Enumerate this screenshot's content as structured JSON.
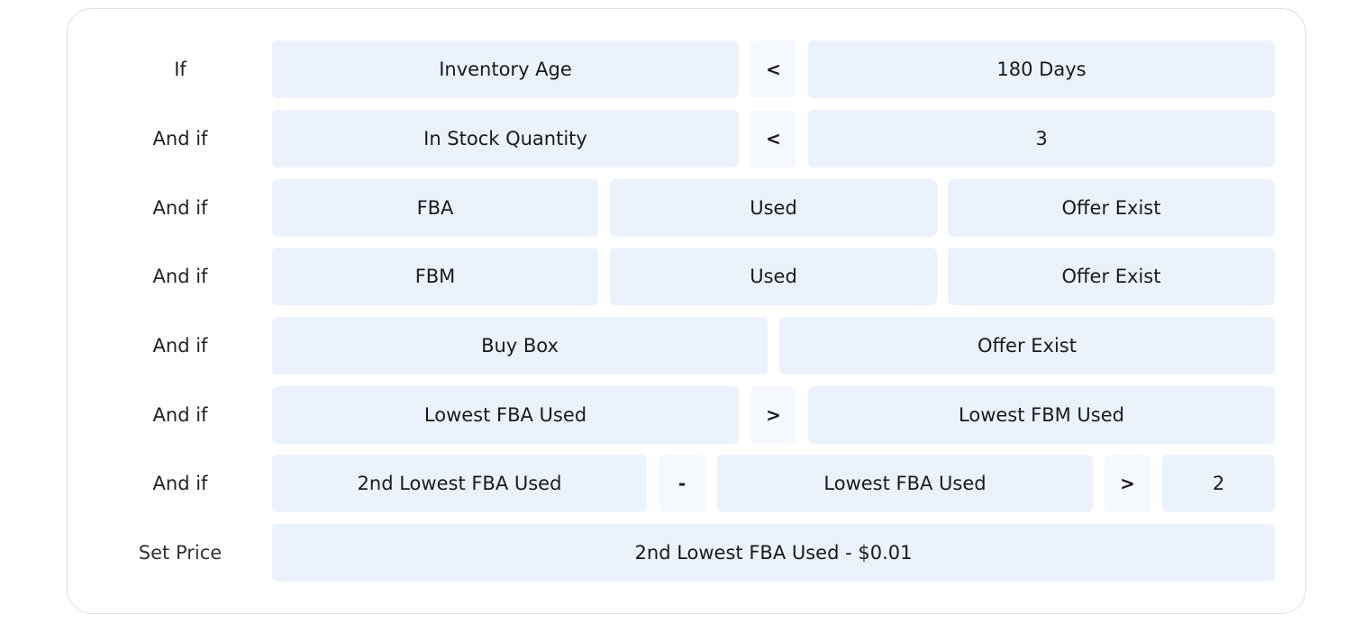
{
  "rules": [
    {
      "label": "If",
      "cells": [
        {
          "text": "Inventory Age",
          "type": "field"
        },
        {
          "text": "<",
          "type": "operator"
        },
        {
          "text": "180 Days",
          "type": "value"
        }
      ]
    },
    {
      "label": "And if",
      "cells": [
        {
          "text": "In Stock Quantity",
          "type": "field"
        },
        {
          "text": "<",
          "type": "operator"
        },
        {
          "text": "3",
          "type": "value"
        }
      ]
    },
    {
      "label": "And if",
      "cells": [
        {
          "text": "FBA",
          "type": "field"
        },
        {
          "text": "Used",
          "type": "field"
        },
        {
          "text": "Offer Exist",
          "type": "value"
        }
      ]
    },
    {
      "label": "And if",
      "cells": [
        {
          "text": "FBM",
          "type": "field"
        },
        {
          "text": "Used",
          "type": "field"
        },
        {
          "text": "Offer Exist",
          "type": "value"
        }
      ]
    },
    {
      "label": "And if",
      "cells": [
        {
          "text": "Buy Box",
          "type": "field"
        },
        {
          "text": "Offer Exist",
          "type": "value"
        }
      ]
    },
    {
      "label": "And if",
      "cells": [
        {
          "text": "Lowest FBA Used",
          "type": "field"
        },
        {
          "text": ">",
          "type": "operator"
        },
        {
          "text": "Lowest FBM Used",
          "type": "field"
        }
      ]
    },
    {
      "label": "And if",
      "cells": [
        {
          "text": "2nd Lowest FBA Used",
          "type": "field"
        },
        {
          "text": "-",
          "type": "operator"
        },
        {
          "text": "Lowest FBA Used",
          "type": "field"
        },
        {
          "text": ">",
          "type": "operator"
        },
        {
          "text": "2",
          "type": "value"
        }
      ]
    },
    {
      "label": "Set Price",
      "cells": [
        {
          "text": "2nd Lowest FBA Used - $0.01",
          "type": "action"
        }
      ]
    }
  ],
  "colors": {
    "cell_bg": "#ebf2fc",
    "operator_bg": "#f5f8fd",
    "card_border": "#dedede",
    "text": "#1a1a1a"
  }
}
